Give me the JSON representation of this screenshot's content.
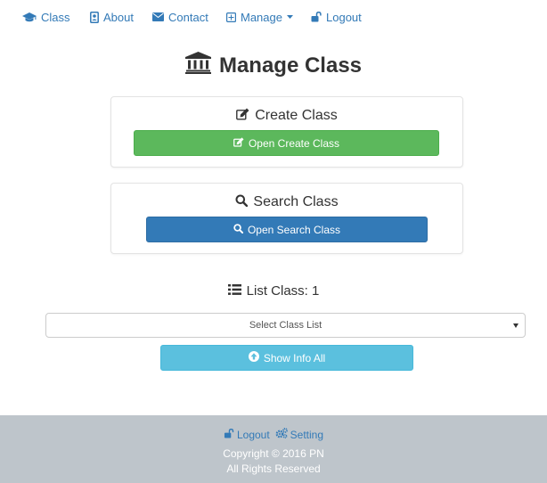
{
  "nav": {
    "items": [
      {
        "label": "Class",
        "icon": "graduation-cap-icon"
      },
      {
        "label": "About",
        "icon": "id-badge-icon"
      },
      {
        "label": "Contact",
        "icon": "envelope-icon"
      },
      {
        "label": "Manage",
        "icon": "plus-square-icon"
      },
      {
        "label": "Logout",
        "icon": "unlock-icon"
      }
    ]
  },
  "page": {
    "title": "Manage Class",
    "title_icon": "institution-icon"
  },
  "create_panel": {
    "title": "Create Class",
    "button_label": "Open Create Class"
  },
  "search_panel": {
    "title": "Search Class",
    "button_label": "Open Search Class"
  },
  "list": {
    "heading": "List Class: 1",
    "select_value": "Select Class List",
    "show_button_label": "Show Info All"
  },
  "footer": {
    "logout_label": "Logout",
    "setting_label": "Setting",
    "copyright": "Copyright © 2016 PN",
    "rights": "All Rights Reserved"
  },
  "colors": {
    "link": "#337ab7",
    "success": "#5cb85c",
    "primary": "#337ab7",
    "info": "#5bc0de",
    "footer_bg": "#bec5cb"
  }
}
